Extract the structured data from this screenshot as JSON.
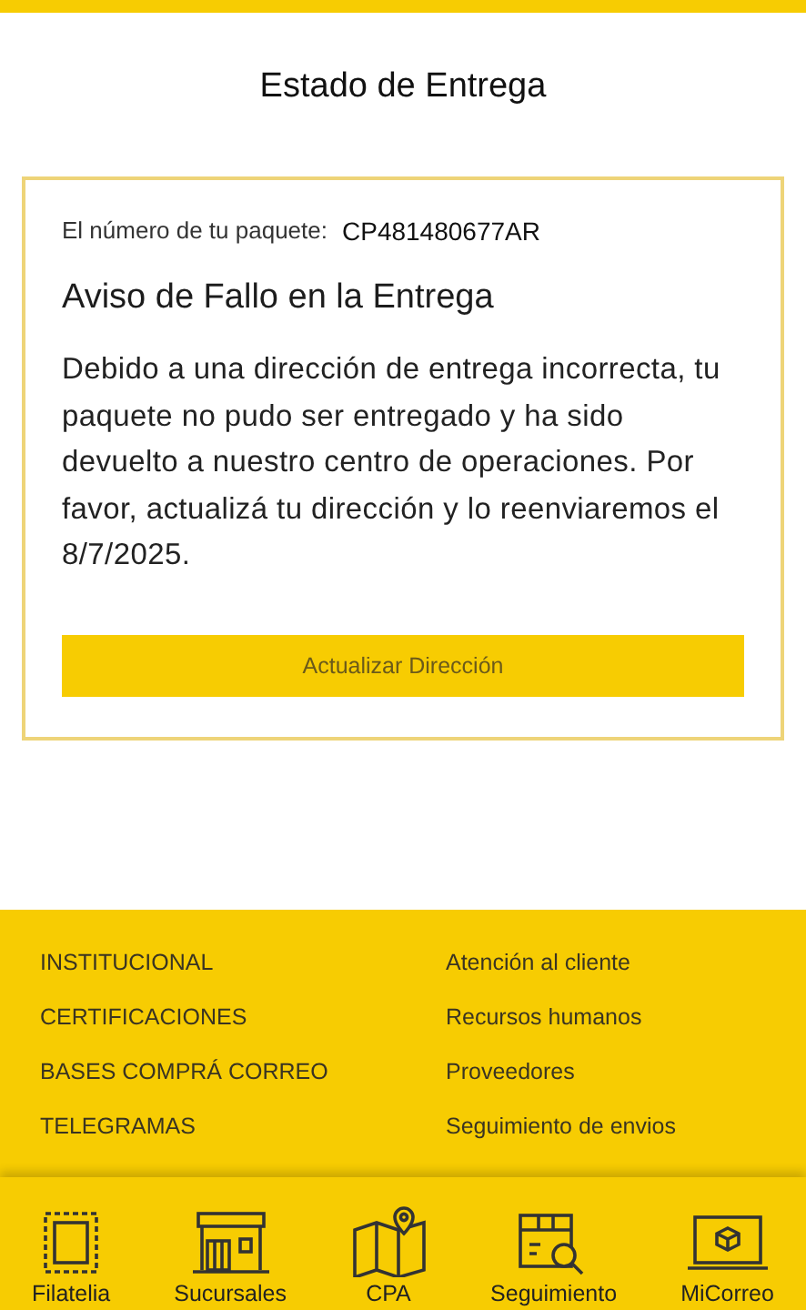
{
  "header": {
    "title": "Estado de Entrega"
  },
  "card": {
    "package_label": "El número de tu paquete:",
    "package_number": "CP481480677AR",
    "heading": "Aviso de Fallo en la Entrega",
    "message": "Debido a una dirección de entrega incorrecta, tu paquete no pudo ser entregado y ha sido devuelto a nuestro centro de operaciones. Por favor, actualizá tu dirección y lo reenviaremos el 8/7/2025.",
    "button": "Actualizar Dirección"
  },
  "footer_links": {
    "left": [
      "INSTITUCIONAL",
      "CERTIFICACIONES",
      "BASES COMPRÁ CORREO",
      "TELEGRAMAS"
    ],
    "right": [
      "Atención al cliente",
      "Recursos humanos",
      "Proveedores",
      "Seguimiento de envios"
    ]
  },
  "bottom_nav": [
    {
      "kind": "stamp",
      "label": "Filatelia"
    },
    {
      "kind": "store",
      "label": "Sucursales"
    },
    {
      "kind": "map",
      "label": "CPA"
    },
    {
      "kind": "tracking",
      "label": "Seguimiento"
    },
    {
      "kind": "laptop",
      "label": "MiCorreo"
    }
  ]
}
